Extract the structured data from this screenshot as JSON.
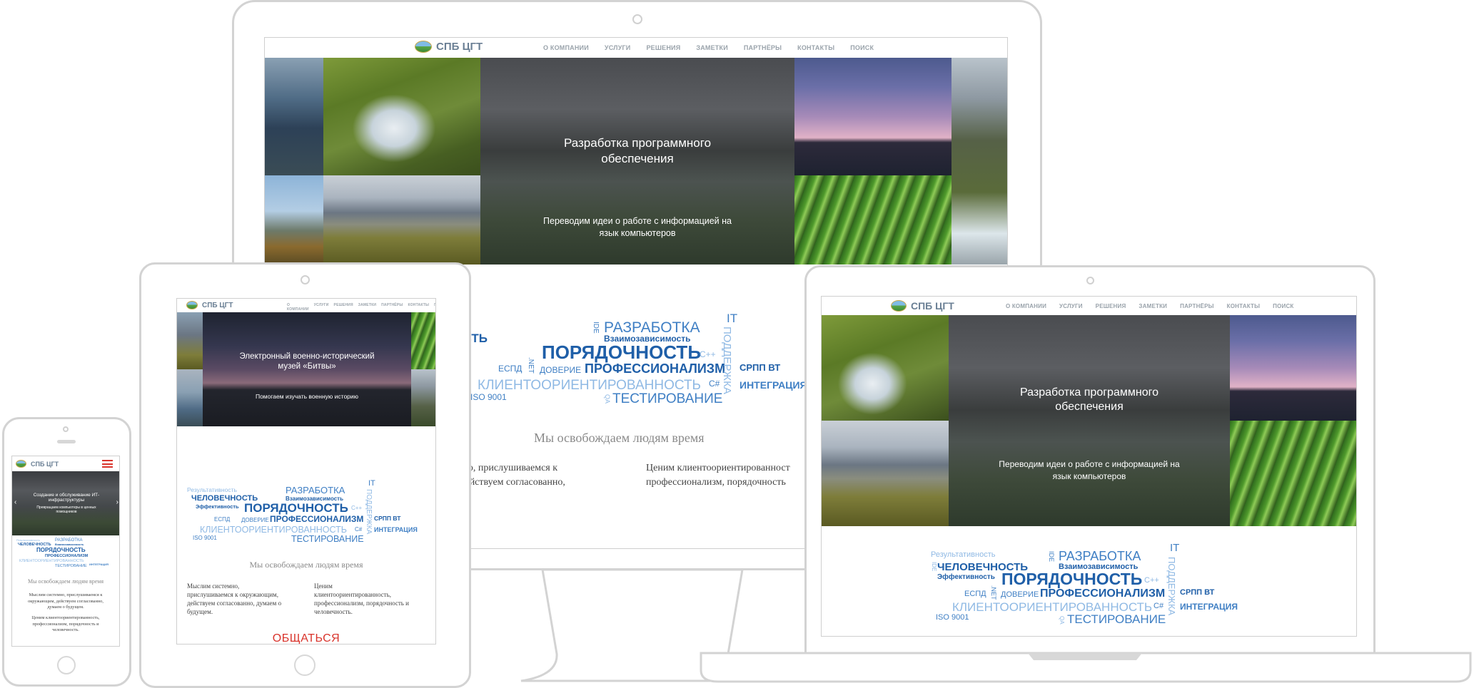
{
  "brand": {
    "name": "СПБ ЦГТ"
  },
  "nav": {
    "items": [
      "О КОМПАНИИ",
      "УСЛУГИ",
      "РЕШЕНИЯ",
      "ЗАМЕТКИ",
      "ПАРТНЁРЫ",
      "КОНТАКТЫ",
      "ПОИСК"
    ]
  },
  "slides": {
    "dev": {
      "title_line1": "Разработка программного",
      "title_line2": "обеспечения",
      "subtitle_line1": "Переводим идеи о работе с информацией на",
      "subtitle_line2": "язык компьютеров"
    },
    "museum": {
      "title_line1": "Электронный военно-исторический",
      "title_line2": "музей «Битвы»",
      "subtitle": "Помогаем изучать военную историю"
    },
    "it": {
      "title_line1": "Создание и обслуживание ИТ-",
      "title_line2": "инфраструктуры",
      "subtitle_line1": "Превращаем компьютеры в ценных",
      "subtitle_line2": "помощников"
    }
  },
  "wordcloud": {
    "rezultativnost": "Результативность",
    "razrabotka": "РАЗРАБОТКА",
    "it": "IT",
    "chelovechnost": "ЧЕЛОВЕЧНОСТЬ",
    "vzaimozavisimost": "Взаимозависимость",
    "effektivnost": "Эффективность",
    "poryadochnost": "ПОРЯДОЧНОСТЬ",
    "cpp": "C++",
    "espd": "ЕСПД",
    "doverie": "ДОВЕРИЕ",
    "professionalizm": "ПРОФЕССИОНАЛИЗМ",
    "srpp": "СРПП ВТ",
    "klientoor": "КЛИЕНТООРИЕНТИРОВАННОСТЬ",
    "csharp": "C#",
    "integraciya": "ИНТЕГРАЦИЯ",
    "iso": "ISO 9001",
    "testirovanie": "ТЕСТИРОВАНИЕ",
    "podderzhka": "ПОДДЕРЖКА",
    "ide": "IDE",
    "net": ".NET",
    "qa": "QA"
  },
  "content": {
    "tagline": "Мы освобождаем людям время",
    "col1_line1": "Мыслим системно,",
    "col1_line2": "прислушиваемся к окружающим,",
    "col1_line3": "действуем согласованно, думаем о",
    "col1_line4": "будущем.",
    "col2_line1": "Ценим",
    "col2_line2": "клиентоориентированность,",
    "col2_line3": "профессионализм, порядочность и",
    "col2_line4": "человечность.",
    "desktop_col1_line1": "стемно, прислушиваемся к",
    "desktop_col1_line2": "им, действуем согласованно,",
    "desktop_col2_line1": "Ценим клиентоориентированност",
    "desktop_col2_line2": "профессионализм, порядочность",
    "phone_col1_line1": "Мыслим системно, прислушиваемся к",
    "phone_col1_line2": "окружающим, действуем согласованно,",
    "phone_col1_line3": "думаем о будущем.",
    "phone_col2_line1": "Ценим клиентоориентированность,",
    "phone_col2_line2": "профессионализм, порядочность и",
    "phone_col2_line3": "человечность.",
    "cta": "ОБЩАТЬСЯ"
  },
  "colors": {
    "accent_red": "#d9332b",
    "word_dark": "#1f5fa8",
    "word_mid": "#3f7fc4",
    "word_light": "#8fb9e4",
    "nav_gray": "#9aa3ab"
  }
}
